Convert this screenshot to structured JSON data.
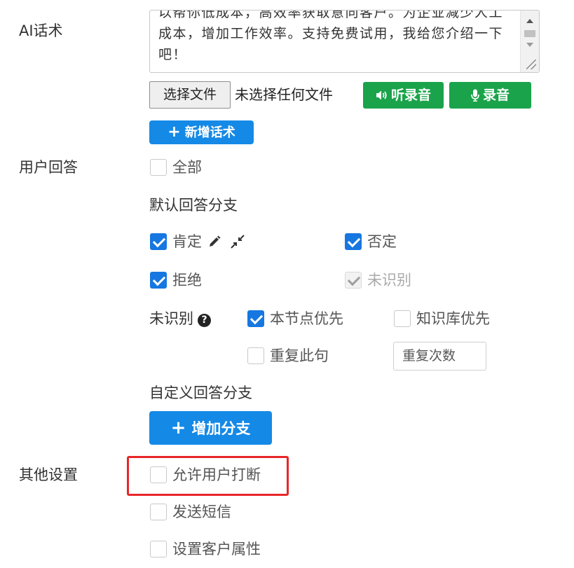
{
  "ai_script": {
    "label": "AI话术",
    "textarea_lines": [
      "以帮你低成本，高效率获取意向客户。为企业减少人工",
      "成本，增加工作效率。支持免费试用，我给您介绍一下",
      "吧！"
    ],
    "choose_file_label": "选择文件",
    "no_file_text": "未选择任何文件",
    "listen_label": "听录音",
    "record_label": "录音",
    "add_script_label": "新增话术"
  },
  "user_answer": {
    "label": "用户回答",
    "all_label": "全部",
    "all_checked": false,
    "default_branch_title": "默认回答分支",
    "branches": {
      "affirm": {
        "label": "肯定",
        "checked": true
      },
      "deny": {
        "label": "否定",
        "checked": true
      },
      "refuse": {
        "label": "拒绝",
        "checked": true
      },
      "unrecognized": {
        "label": "未识别",
        "checked": true,
        "disabled": true
      }
    },
    "unrecognized_row": {
      "label": "未识别",
      "node_priority_label": "本节点优先",
      "node_priority_checked": true,
      "kb_priority_label": "知识库优先",
      "kb_priority_checked": false,
      "repeat_label": "重复此句",
      "repeat_checked": false,
      "repeat_count_placeholder": "重复次数"
    },
    "custom_branch_title": "自定义回答分支",
    "add_branch_label": "增加分支"
  },
  "other_settings": {
    "label": "其他设置",
    "allow_interrupt_label": "允许用户打断",
    "allow_interrupt_checked": false,
    "send_sms_label": "发送短信",
    "send_sms_checked": false,
    "set_customer_attr_label": "设置客户属性",
    "set_customer_attr_checked": false
  },
  "colors": {
    "primary_blue": "#1589e6",
    "checkbox_blue": "#1677e0",
    "green": "#1aa34a",
    "highlight_red": "#e8262a"
  }
}
